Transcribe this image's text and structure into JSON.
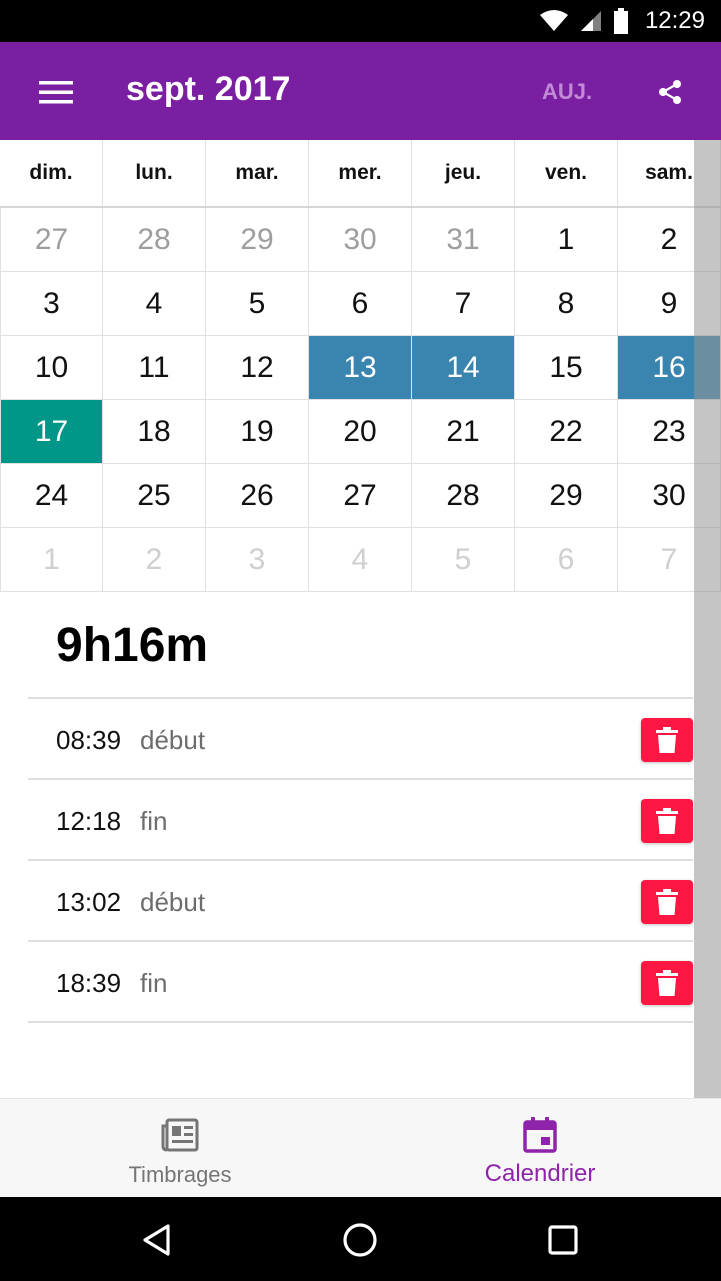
{
  "status_bar": {
    "time": "12:29"
  },
  "app_bar": {
    "title": "sept. 2017",
    "today_label": "AUJ."
  },
  "calendar": {
    "weekdays": [
      "dim.",
      "lun.",
      "mar.",
      "mer.",
      "jeu.",
      "ven.",
      "sam."
    ],
    "weeks": [
      [
        {
          "d": "27",
          "s": "prev"
        },
        {
          "d": "28",
          "s": "prev"
        },
        {
          "d": "29",
          "s": "prev"
        },
        {
          "d": "30",
          "s": "prev"
        },
        {
          "d": "31",
          "s": "prev"
        },
        {
          "d": "1",
          "s": ""
        },
        {
          "d": "2",
          "s": ""
        }
      ],
      [
        {
          "d": "3",
          "s": ""
        },
        {
          "d": "4",
          "s": ""
        },
        {
          "d": "5",
          "s": ""
        },
        {
          "d": "6",
          "s": ""
        },
        {
          "d": "7",
          "s": ""
        },
        {
          "d": "8",
          "s": ""
        },
        {
          "d": "9",
          "s": ""
        }
      ],
      [
        {
          "d": "10",
          "s": ""
        },
        {
          "d": "11",
          "s": ""
        },
        {
          "d": "12",
          "s": ""
        },
        {
          "d": "13",
          "s": "sel"
        },
        {
          "d": "14",
          "s": "sel"
        },
        {
          "d": "15",
          "s": ""
        },
        {
          "d": "16",
          "s": "sel"
        }
      ],
      [
        {
          "d": "17",
          "s": "today"
        },
        {
          "d": "18",
          "s": ""
        },
        {
          "d": "19",
          "s": ""
        },
        {
          "d": "20",
          "s": ""
        },
        {
          "d": "21",
          "s": ""
        },
        {
          "d": "22",
          "s": ""
        },
        {
          "d": "23",
          "s": ""
        }
      ],
      [
        {
          "d": "24",
          "s": ""
        },
        {
          "d": "25",
          "s": ""
        },
        {
          "d": "26",
          "s": ""
        },
        {
          "d": "27",
          "s": ""
        },
        {
          "d": "28",
          "s": ""
        },
        {
          "d": "29",
          "s": ""
        },
        {
          "d": "30",
          "s": ""
        }
      ],
      [
        {
          "d": "1",
          "s": "next"
        },
        {
          "d": "2",
          "s": "next"
        },
        {
          "d": "3",
          "s": "next"
        },
        {
          "d": "4",
          "s": "next"
        },
        {
          "d": "5",
          "s": "next"
        },
        {
          "d": "6",
          "s": "next"
        },
        {
          "d": "7",
          "s": "next"
        }
      ]
    ]
  },
  "summary": {
    "total": "9h16m",
    "entries": [
      {
        "time": "08:39",
        "type": "début"
      },
      {
        "time": "12:18",
        "type": "fin"
      },
      {
        "time": "13:02",
        "type": "début"
      },
      {
        "time": "18:39",
        "type": "fin"
      }
    ]
  },
  "bottom_nav": {
    "items": [
      {
        "label": "Timbrages",
        "icon": "newspaper-icon",
        "active": false
      },
      {
        "label": "Calendrier",
        "icon": "calendar-icon",
        "active": true
      }
    ]
  },
  "colors": {
    "app_bar": "#7b1fa2",
    "selected_day": "#3a85b0",
    "today": "#009688",
    "delete": "#ff1744",
    "active_nav": "#8e24aa"
  }
}
